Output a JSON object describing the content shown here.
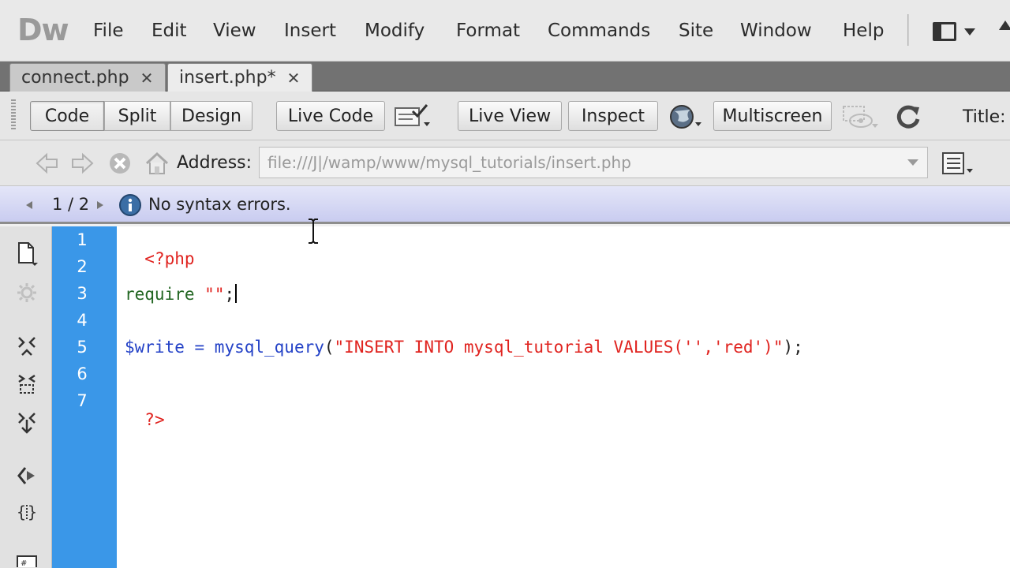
{
  "app": {
    "logo": "Dw",
    "menu": [
      "File",
      "Edit",
      "View",
      "Insert",
      "Modify",
      "Format",
      "Commands",
      "Site",
      "Window",
      "Help"
    ]
  },
  "tabs": [
    {
      "label": "connect.php",
      "active": false
    },
    {
      "label": "insert.php*",
      "active": true
    }
  ],
  "toolbar": {
    "code": "Code",
    "split": "Split",
    "design": "Design",
    "live_code": "Live Code",
    "live_view": "Live View",
    "inspect": "Inspect",
    "multiscreen": "Multiscreen",
    "title_label": "Title:"
  },
  "address": {
    "label": "Address:",
    "value": "file:///J|/wamp/www/mysql_tutorials/insert.php"
  },
  "info": {
    "pager": "1 / 2",
    "message": "No syntax errors."
  },
  "code": {
    "line_numbers": [
      "1",
      "2",
      "3",
      "4",
      "5",
      "6",
      "7"
    ],
    "line1": "<?php",
    "line3_keyword": "require",
    "line3_string": "\"\"",
    "line3_end": ";",
    "line5_var": "$write",
    "line5_op": " = ",
    "line5_func": "mysql_query",
    "line5_open": "(",
    "line5_string": "\"INSERT INTO mysql_tutorial VALUES('','red')\"",
    "line5_close": ");",
    "line7": "?>"
  },
  "colors": {
    "gutter": "#3a97e8",
    "php_tag": "#e0231f",
    "keyword": "#226622",
    "function": "#2442c7",
    "string": "#e0231f"
  }
}
